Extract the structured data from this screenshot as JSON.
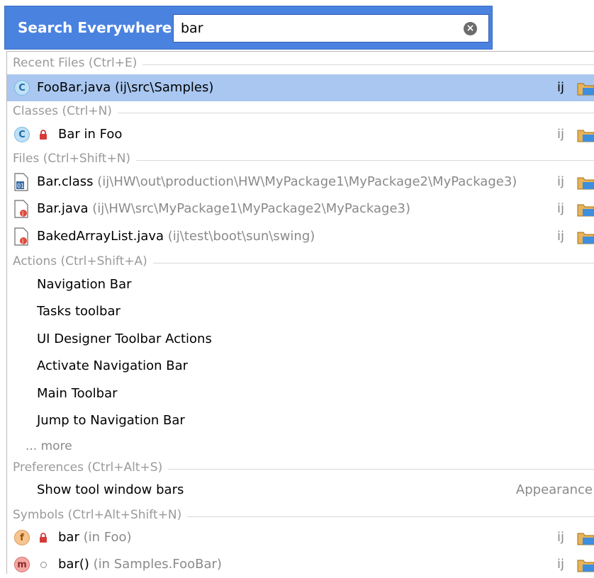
{
  "header": {
    "label": "Search Everywhere:",
    "query": "bar"
  },
  "groups": {
    "recent": {
      "title": "Recent Files (Ctrl+E)",
      "items": [
        {
          "name": "FooBar.java",
          "path": " (ij\\src\\Samples)",
          "module": "ij"
        }
      ]
    },
    "classes": {
      "title": "Classes (Ctrl+N)",
      "items": [
        {
          "name": "Bar in Foo",
          "module": "ij"
        }
      ]
    },
    "files": {
      "title": "Files (Ctrl+Shift+N)",
      "items": [
        {
          "name": "Bar.class",
          "path": " (ij\\HW\\out\\production\\HW\\MyPackage1\\MyPackage2\\MyPackage3)",
          "module": "ij"
        },
        {
          "name": "Bar.java",
          "path": " (ij\\HW\\src\\MyPackage1\\MyPackage2\\MyPackage3)",
          "module": "ij"
        },
        {
          "name": "BakedArrayList.java",
          "path": " (ij\\test\\boot\\sun\\swing)",
          "module": "ij"
        }
      ]
    },
    "actions": {
      "title": "Actions (Ctrl+Shift+A)",
      "items": [
        "Navigation Bar",
        "Tasks toolbar",
        "UI Designer Toolbar Actions",
        "Activate Navigation Bar",
        "Main Toolbar",
        "Jump to Navigation Bar"
      ],
      "more": "... more"
    },
    "preferences": {
      "title": "Preferences (Ctrl+Alt+S)",
      "items": [
        {
          "name": "Show tool window bars",
          "category": "Appearance"
        }
      ]
    },
    "symbols": {
      "title": "Symbols (Ctrl+Alt+Shift+N)",
      "items": [
        {
          "name": "bar",
          "context": " (in Foo)",
          "module": "ij",
          "kind_letter": "f"
        },
        {
          "name": "bar()",
          "context": " (in Samples.FooBar)",
          "module": "ij",
          "kind_letter": "m"
        }
      ]
    }
  },
  "icons": {
    "clear": "clear-search-icon",
    "folder": "module-folder-icon",
    "lock": "private-lock-icon"
  },
  "colors": {
    "header_bg": "#4a82e0",
    "selection": "#a9c7f0",
    "group_text": "#9a9a9a"
  }
}
